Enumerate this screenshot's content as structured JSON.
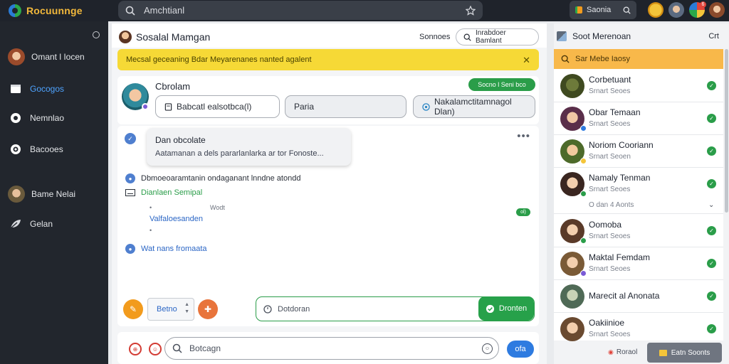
{
  "app": {
    "brand": "Rocuunnge",
    "search_value": "Amchtianl",
    "chip_label": "Saonia",
    "notification_count": "6"
  },
  "sidebar": {
    "items": [
      {
        "label": "Omant l Iocen",
        "icon": "user-avatar"
      },
      {
        "label": "Gocogos",
        "icon": "folder-icon",
        "active": true
      },
      {
        "label": "Nemnlao",
        "icon": "circle-icon"
      },
      {
        "label": "Bacooes",
        "icon": "camera-icon"
      },
      {
        "label": "Bame Nelai",
        "icon": "user-avatar"
      },
      {
        "label": "Gelan",
        "icon": "leaf-icon"
      }
    ]
  },
  "header": {
    "title": "Sosalal Mamgan",
    "link": "Sonnoes",
    "button": "Inrabdoer Bamlant"
  },
  "banner": {
    "text": "Mecsal geceaning Bdar Meyarenanes nanted agalent"
  },
  "profile": {
    "name": "Cbrolam",
    "status": "Socno l Seni bco",
    "field1": "Babcatl ealsotbca(l)",
    "field2": "Paria",
    "field3": "Nakalamctitamnagol Dlan)"
  },
  "chat": {
    "bubble_title": "Dan obcolate",
    "bubble_text": "Aatamanan a dels pararlanlarka ar tor Fonoste...",
    "line1": "Dbmoeoaramtanin ondaganant lnndne atondd",
    "line2": "Dianlaen Semipal",
    "line3_left": "Valfaloesanden",
    "line3_right": "Wodt",
    "mini_badge": "ol)",
    "line4": "Wat nans fromaata",
    "stepper_value": "Betno",
    "input_placeholder": "Dotdoran",
    "send_label": "Dronten"
  },
  "compose": {
    "placeholder": "Botcagn",
    "send": "ofa"
  },
  "right_panel": {
    "title": "Soot Merenoan",
    "right_label": "Crt",
    "subheader": "Sar Mebe Iaosy",
    "contacts": [
      {
        "name": "Corbetuant",
        "sub": "Srnart Seoes"
      },
      {
        "name": "Obar Temaan",
        "sub": "Srnart Seoes"
      },
      {
        "name": "Noriom Cooriann",
        "sub": "Srnart Seoen"
      },
      {
        "name": "Namaly Tenman",
        "sub": "Srnart Seoes",
        "extra": "O dan 4 Aonts"
      },
      {
        "name": "Oomoba",
        "sub": "Srnart Seoes"
      },
      {
        "name": "Maktal Femdam",
        "sub": "Srnart Seoes"
      },
      {
        "name": "Marecit al Anonata",
        "sub": ""
      },
      {
        "name": "Oakiinioe",
        "sub": "Srnart Seoes"
      }
    ],
    "footer_left": "Roraol",
    "footer_button": "Eatn Soonts"
  }
}
